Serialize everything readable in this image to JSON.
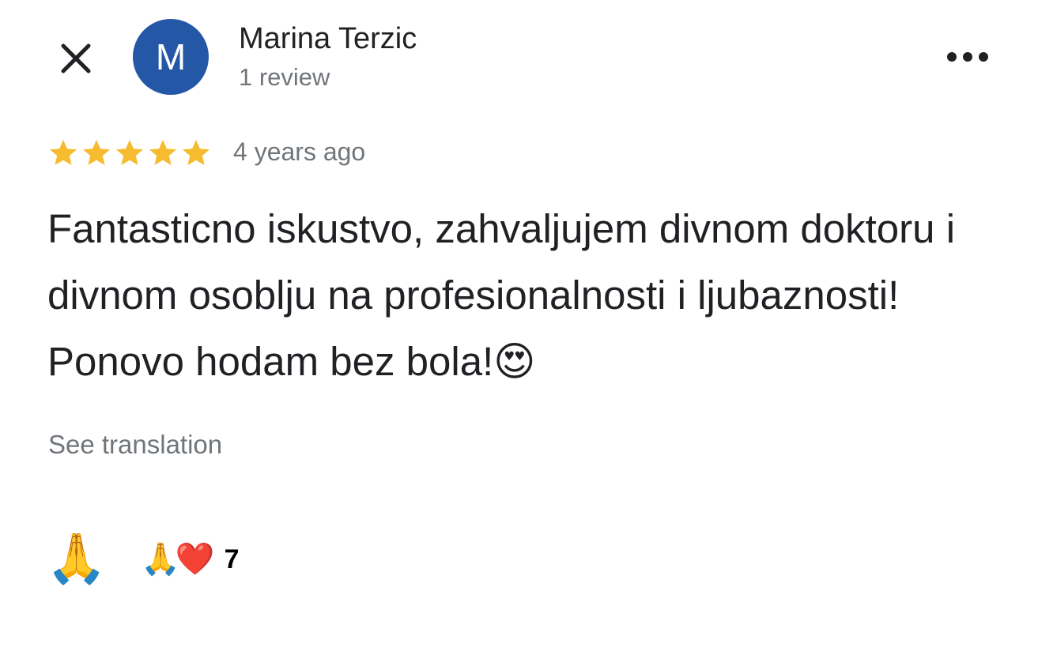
{
  "header": {
    "close_icon": "close-icon",
    "avatar_letter": "M",
    "avatar_color": "#2457a6",
    "author_name": "Marina Terzic",
    "review_count": "1 review",
    "more_icon": "more-horizontal-icon"
  },
  "review": {
    "rating": 5,
    "rating_max": 5,
    "star_color": "#f6bb2e",
    "time_ago": "4 years ago",
    "text": "Fantasticno iskustvo, zahvaljujem divnom doktoru i divnom osoblju na profesionalnosti i ljubaznosti! Ponovo hodam bez bola!😍",
    "see_translation": "See translation"
  },
  "reactions": {
    "react_button_emoji": "🙏",
    "summary_emojis": [
      "🙏",
      "❤️"
    ],
    "count": "7"
  }
}
